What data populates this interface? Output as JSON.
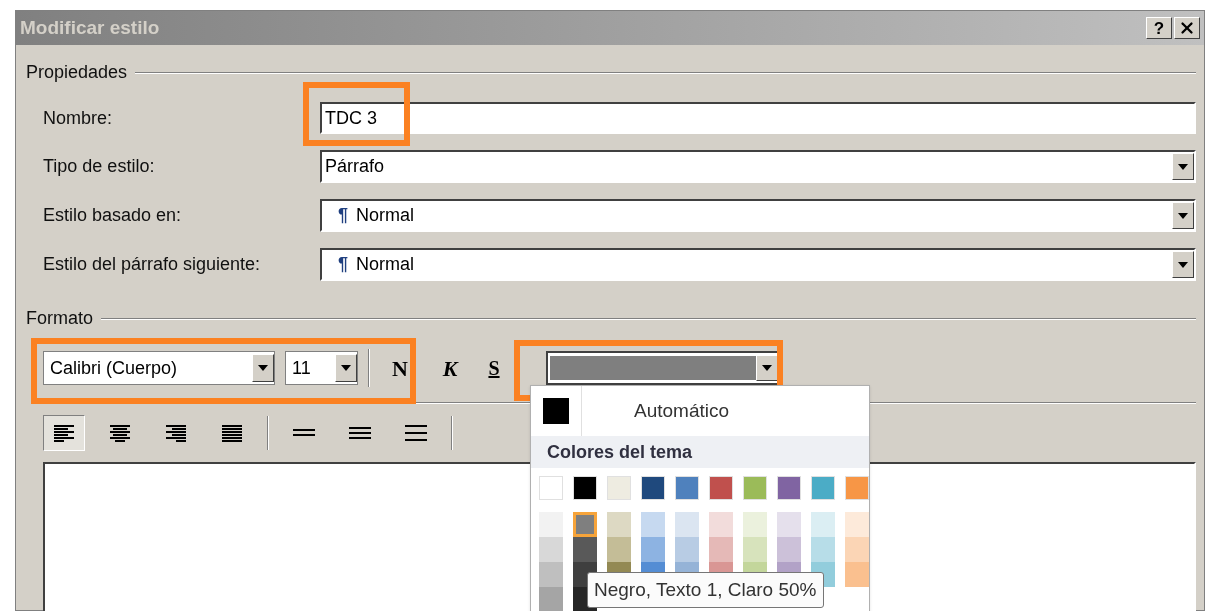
{
  "window": {
    "title": "Modificar estilo",
    "help": "?"
  },
  "properties": {
    "legend": "Propiedades",
    "fields": [
      {
        "label": "Nombre:",
        "kind": "text",
        "value": "TDC 3",
        "highlighted": true
      },
      {
        "label": "Tipo de estilo:",
        "kind": "select",
        "value": "Párrafo",
        "highlighted": false
      },
      {
        "label": "Estilo basado en:",
        "kind": "select",
        "mark": "¶",
        "value": "Normal",
        "highlighted": false
      },
      {
        "label": "Estilo del párrafo siguiente:",
        "kind": "select",
        "mark": "¶",
        "value": "Normal",
        "highlighted": false
      }
    ]
  },
  "format": {
    "legend": "Formato",
    "font": "Calibri (Cuerpo)",
    "size": "11",
    "bold": "N",
    "italic": "K",
    "underline": "S",
    "font_color": {
      "color": "#7f7f7f"
    },
    "alignment": [
      {
        "kind": "left",
        "selected": true
      },
      {
        "kind": "center",
        "selected": false
      },
      {
        "kind": "right",
        "selected": false
      },
      {
        "kind": "justify",
        "selected": false
      }
    ],
    "spacing": [
      {
        "kind": "single"
      },
      {
        "kind": "one-half"
      },
      {
        "kind": "double"
      }
    ]
  },
  "color_menu": {
    "automatic": {
      "label": "Automático",
      "color": "#000000"
    },
    "section": "Colores del tema",
    "theme": [
      {
        "color": "#ffffff"
      },
      {
        "color": "#000000"
      },
      {
        "color": "#eeece1"
      },
      {
        "color": "#1f497d"
      },
      {
        "color": "#4f81bd"
      },
      {
        "color": "#c0504d"
      },
      {
        "color": "#9bbb59"
      },
      {
        "color": "#8064a2"
      },
      {
        "color": "#4bacc6"
      },
      {
        "color": "#f79646"
      }
    ],
    "shades": [
      [
        {
          "color": "#f2f2f2",
          "selected": false
        },
        {
          "color": "#7f7f7f",
          "selected": true
        },
        {
          "color": "#ddd9c3",
          "selected": false
        },
        {
          "color": "#c6d9f0",
          "selected": false
        },
        {
          "color": "#dbe5f1",
          "selected": false
        },
        {
          "color": "#f2dcdb",
          "selected": false
        },
        {
          "color": "#ebf1dd",
          "selected": false
        },
        {
          "color": "#e5e0ec",
          "selected": false
        },
        {
          "color": "#dbeef3",
          "selected": false
        },
        {
          "color": "#fdeada",
          "selected": false
        }
      ],
      [
        {
          "color": "#d8d8d8",
          "selected": false
        },
        {
          "color": "#595959",
          "selected": false
        },
        {
          "color": "#c4bd97",
          "selected": false
        },
        {
          "color": "#8db3e2",
          "selected": false
        },
        {
          "color": "#b8cce4",
          "selected": false
        },
        {
          "color": "#e5b9b7",
          "selected": false
        },
        {
          "color": "#d7e3bc",
          "selected": false
        },
        {
          "color": "#ccc1d9",
          "selected": false
        },
        {
          "color": "#b7dde8",
          "selected": false
        },
        {
          "color": "#fbd5b5",
          "selected": false
        }
      ],
      [
        {
          "color": "#bfbfbf",
          "selected": false
        },
        {
          "color": "#3f3f3f",
          "selected": false
        },
        {
          "color": "#938953",
          "selected": false
        },
        {
          "color": "#548dd4",
          "selected": false
        },
        {
          "color": "#95b3d7",
          "selected": false
        },
        {
          "color": "#d99694",
          "selected": false
        },
        {
          "color": "#c3d69b",
          "selected": false
        },
        {
          "color": "#b2a2c7",
          "selected": false
        },
        {
          "color": "#92cddc",
          "selected": false
        },
        {
          "color": "#fac08f",
          "selected": false
        }
      ],
      [
        {
          "color": "#a5a5a5",
          "selected": false
        },
        {
          "color": "#262626",
          "selected": false
        }
      ]
    ],
    "tooltip": "Negro, Texto 1, Claro 50%"
  }
}
